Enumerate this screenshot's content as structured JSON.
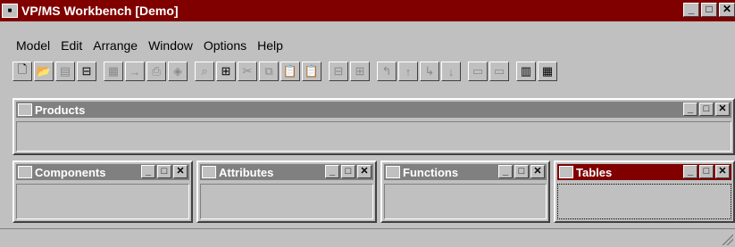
{
  "window": {
    "title": "VP/MS Workbench [Demo]",
    "icon": "app-icon",
    "controls": [
      "_",
      "□",
      "✕"
    ]
  },
  "menu": [
    "Model",
    "Edit",
    "Arrange",
    "Window",
    "Options",
    "Help"
  ],
  "toolbar": [
    {
      "name": "new-document-icon",
      "glyph": "🗋",
      "enabled": true
    },
    {
      "name": "open-folder-icon",
      "glyph": "📂",
      "enabled": true
    },
    {
      "name": "save-icon",
      "glyph": "▤",
      "enabled": false
    },
    {
      "name": "window-icon",
      "glyph": "⊟",
      "enabled": true
    },
    {
      "sep": true
    },
    {
      "name": "grid-icon",
      "glyph": "▦",
      "enabled": false
    },
    {
      "name": "arrow-dots-icon",
      "glyph": "→",
      "enabled": false
    },
    {
      "name": "print-icon",
      "glyph": "⎙",
      "enabled": false
    },
    {
      "name": "erase-icon",
      "glyph": "◈",
      "enabled": false
    },
    {
      "sep": true
    },
    {
      "name": "zoom-icon",
      "glyph": "⌕",
      "enabled": false
    },
    {
      "name": "ruler-icon",
      "glyph": "⊞",
      "enabled": true
    },
    {
      "name": "cut-icon",
      "glyph": "✂",
      "enabled": false
    },
    {
      "name": "copy-icon",
      "glyph": "⧉",
      "enabled": false
    },
    {
      "name": "paste-icon",
      "glyph": "📋",
      "enabled": false
    },
    {
      "name": "paste-special-icon",
      "glyph": "📋",
      "enabled": false
    },
    {
      "sep": true
    },
    {
      "name": "minus-box-icon",
      "glyph": "⊟",
      "enabled": false
    },
    {
      "name": "plus-box-icon",
      "glyph": "⊞",
      "enabled": false
    },
    {
      "sep": true
    },
    {
      "name": "arrow-up-left-icon",
      "glyph": "↰",
      "enabled": false
    },
    {
      "name": "arrow-up-icon",
      "glyph": "↑",
      "enabled": false
    },
    {
      "name": "arrow-down-right-icon",
      "glyph": "↳",
      "enabled": false
    },
    {
      "name": "arrow-down-icon",
      "glyph": "↓",
      "enabled": false
    },
    {
      "sep": true
    },
    {
      "name": "link-icon",
      "glyph": "▭",
      "enabled": false
    },
    {
      "name": "unlink-icon",
      "glyph": "▭",
      "enabled": false
    },
    {
      "sep": true
    },
    {
      "name": "table-icon",
      "glyph": "▥",
      "enabled": true
    },
    {
      "name": "table-grid-icon",
      "glyph": "▦",
      "enabled": true
    }
  ],
  "panes": [
    {
      "key": "products",
      "title": "Products",
      "active": false
    },
    {
      "key": "components",
      "title": "Components",
      "active": false
    },
    {
      "key": "attributes",
      "title": "Attributes",
      "active": false
    },
    {
      "key": "functions",
      "title": "Functions",
      "active": false
    },
    {
      "key": "tables",
      "title": "Tables",
      "active": true
    }
  ],
  "pane_controls": [
    "_",
    "□",
    "✕"
  ]
}
